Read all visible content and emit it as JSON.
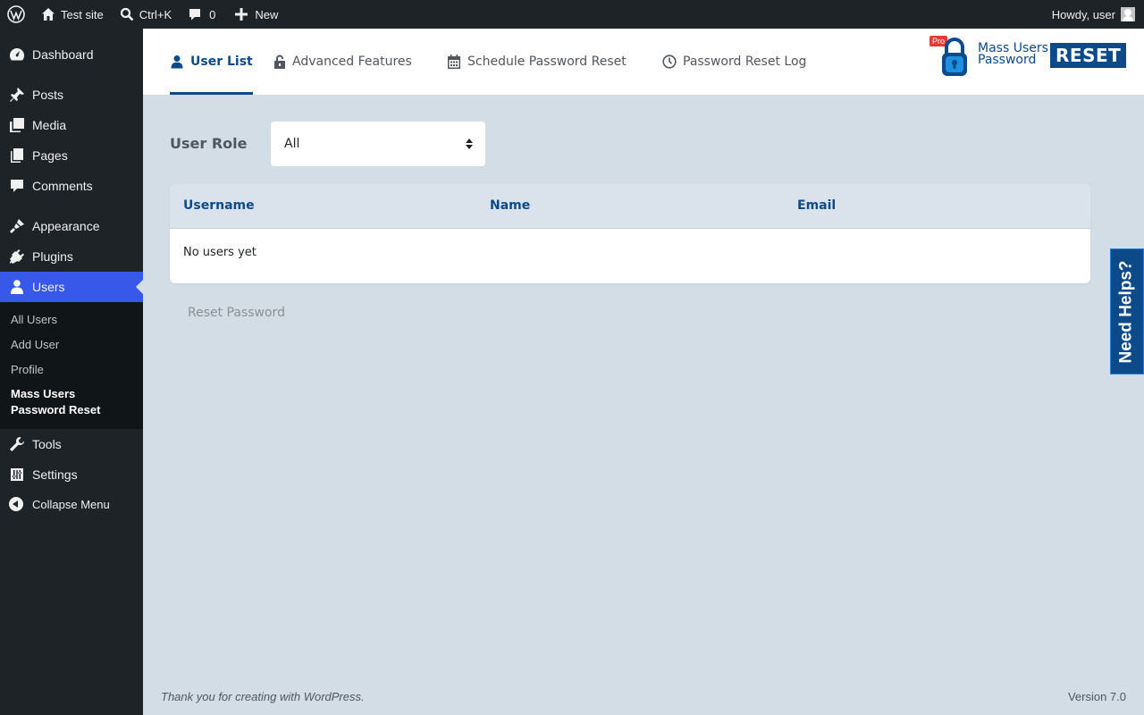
{
  "adminbar": {
    "site_name": "Test site",
    "search_shortcut": "Ctrl+K",
    "comments_count": "0",
    "new_label": "New",
    "howdy": "Howdy, user"
  },
  "sidebar": {
    "items": [
      {
        "label": "Dashboard",
        "icon": "dashboard-icon"
      },
      {
        "label": "Posts",
        "icon": "pin-icon"
      },
      {
        "label": "Media",
        "icon": "media-icon"
      },
      {
        "label": "Pages",
        "icon": "pages-icon"
      },
      {
        "label": "Comments",
        "icon": "comment-icon"
      },
      {
        "label": "Appearance",
        "icon": "brush-icon"
      },
      {
        "label": "Plugins",
        "icon": "plug-icon"
      },
      {
        "label": "Users",
        "icon": "user-icon"
      },
      {
        "label": "Tools",
        "icon": "wrench-icon"
      },
      {
        "label": "Settings",
        "icon": "sliders-icon"
      }
    ],
    "submenu": [
      "All Users",
      "Add User",
      "Profile",
      "Mass Users Password Reset"
    ],
    "collapse_label": "Collapse Menu"
  },
  "tabs": [
    {
      "label": "User List",
      "icon": "user-icon"
    },
    {
      "label": "Advanced Features",
      "icon": "lock-icon"
    },
    {
      "label": "Schedule Password Reset",
      "icon": "calendar-icon"
    },
    {
      "label": "Password Reset Log",
      "icon": "clock-icon"
    }
  ],
  "logo": {
    "badge": "Pro",
    "line1": "Mass Users",
    "line2": "Password",
    "reset": "RESET"
  },
  "filter": {
    "label": "User Role",
    "selected": "All"
  },
  "table": {
    "columns": [
      "Username",
      "Name",
      "Email"
    ],
    "empty_message": "No users yet"
  },
  "reset_button": "Reset Password",
  "need_help": "Need Helps?",
  "footer": {
    "thanks": "Thank you for creating with WordPress.",
    "version": "Version 7.0"
  },
  "colors": {
    "admin_dark": "#1d2327",
    "accent_blue": "#3858e9",
    "brand_blue": "#0c4a8a",
    "content_bg": "#d3dde6"
  }
}
